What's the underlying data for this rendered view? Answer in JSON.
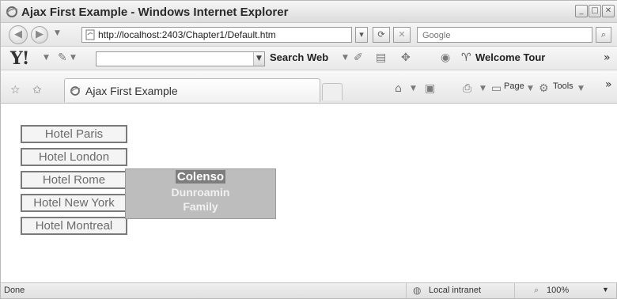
{
  "window": {
    "title": "Ajax First Example - Windows Internet Explorer",
    "controls": {
      "minimize": "_",
      "maximize": "□",
      "close": "✕"
    }
  },
  "address_bar": {
    "url": "http://localhost:2403/Chapter1/Default.htm",
    "search_placeholder": "Google"
  },
  "yahoo_toolbar": {
    "logo": "Y!",
    "search_button": "Search Web",
    "welcome": "Welcome Tour"
  },
  "tab_bar": {
    "tab_title": "Ajax First Example",
    "page_menu": "Page",
    "tools_menu": "Tools"
  },
  "content": {
    "hotels": [
      {
        "label": "Hotel Paris"
      },
      {
        "label": "Hotel London"
      },
      {
        "label": "Hotel Rome"
      },
      {
        "label": "Hotel New York"
      },
      {
        "label": "Hotel Montreal"
      }
    ],
    "popup": {
      "title": "Colenso",
      "lines": [
        "Dunroamin",
        "Family"
      ]
    }
  },
  "status_bar": {
    "status": "Done",
    "zone": "Local intranet",
    "zoom": "100%"
  }
}
